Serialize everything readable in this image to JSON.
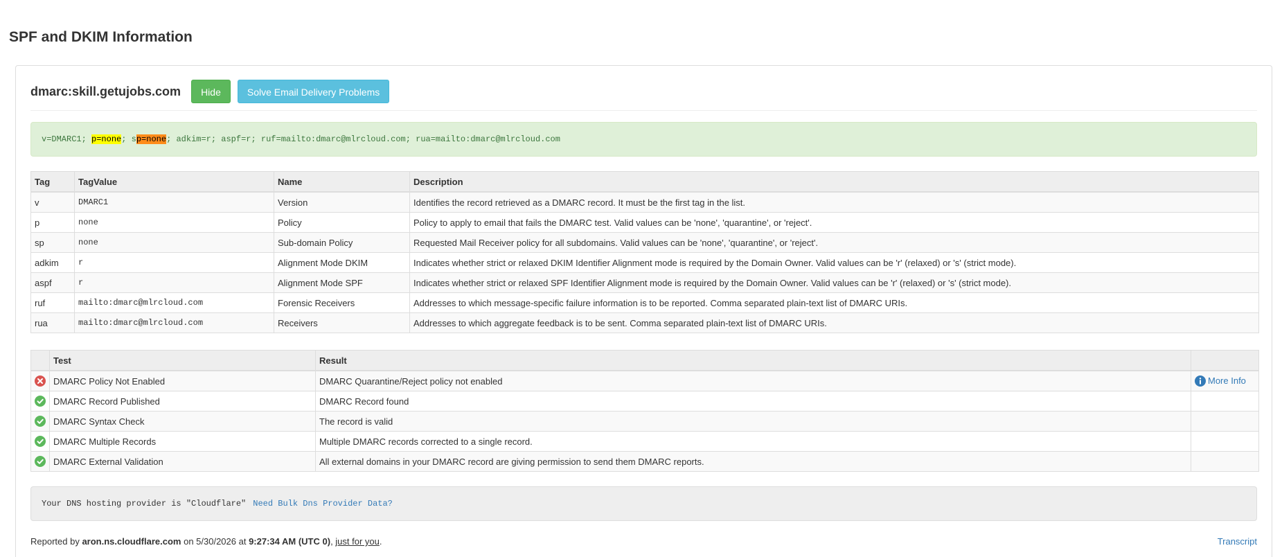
{
  "page_title": "SPF and DKIM Information",
  "header": {
    "domain": "dmarc:skill.getujobs.com",
    "hide_label": "Hide",
    "solve_label": "Solve Email Delivery Problems"
  },
  "record": {
    "part1": "v=DMARC1; ",
    "p_highlight": "p=none",
    "part2": "; s",
    "sp_highlight": "p=none",
    "part3": "; adkim=r; aspf=r; ruf=mailto:dmarc@mlrcloud.com; rua=mailto:dmarc@mlrcloud.com",
    "colors": {
      "green_bg": "#dff0d8",
      "text": "#3c763d",
      "highlight_yellow": "#ffff00",
      "highlight_orange": "#ff8c1a"
    }
  },
  "tag_table": {
    "headers": [
      "Tag",
      "TagValue",
      "Name",
      "Description"
    ],
    "rows": [
      {
        "tag": "v",
        "value": "DMARC1",
        "name": "Version",
        "description": "Identifies the record retrieved as a DMARC record. It must be the first tag in the list."
      },
      {
        "tag": "p",
        "value": "none",
        "name": "Policy",
        "description": "Policy to apply to email that fails the DMARC test. Valid values can be 'none', 'quarantine', or 'reject'."
      },
      {
        "tag": "sp",
        "value": "none",
        "name": "Sub-domain Policy",
        "description": "Requested Mail Receiver policy for all subdomains. Valid values can be 'none', 'quarantine', or 'reject'."
      },
      {
        "tag": "adkim",
        "value": "r",
        "name": "Alignment Mode DKIM",
        "description": "Indicates whether strict or relaxed DKIM Identifier Alignment mode is required by the Domain Owner. Valid values can be 'r' (relaxed) or 's' (strict mode)."
      },
      {
        "tag": "aspf",
        "value": "r",
        "name": "Alignment Mode SPF",
        "description": "Indicates whether strict or relaxed SPF Identifier Alignment mode is required by the Domain Owner. Valid values can be 'r' (relaxed) or 's' (strict mode)."
      },
      {
        "tag": "ruf",
        "value": "mailto:dmarc@mlrcloud.com",
        "name": "Forensic Receivers",
        "description": "Addresses to which message-specific failure information is to be reported. Comma separated plain-text list of DMARC URIs."
      },
      {
        "tag": "rua",
        "value": "mailto:dmarc@mlrcloud.com",
        "name": "Receivers",
        "description": "Addresses to which aggregate feedback is to be sent. Comma separated plain-text list of DMARC URIs."
      }
    ]
  },
  "test_table": {
    "headers": [
      "",
      "Test",
      "Result",
      ""
    ],
    "rows": [
      {
        "status": "error",
        "icon": "error-icon",
        "test": "DMARC Policy Not Enabled",
        "result": "DMARC Quarantine/Reject policy not enabled",
        "more": "More Info"
      },
      {
        "status": "ok",
        "icon": "check-icon",
        "test": "DMARC Record Published",
        "result": "DMARC Record found",
        "more": ""
      },
      {
        "status": "ok",
        "icon": "check-icon",
        "test": "DMARC Syntax Check",
        "result": "The record is valid",
        "more": ""
      },
      {
        "status": "ok",
        "icon": "check-icon",
        "test": "DMARC Multiple Records",
        "result": "Multiple DMARC records corrected to a single record.",
        "more": ""
      },
      {
        "status": "ok",
        "icon": "check-icon",
        "test": "DMARC External Validation",
        "result": "All external domains in your DMARC record are giving permission to send them DMARC reports.",
        "more": ""
      }
    ],
    "colors": {
      "error": "#d9534f",
      "ok": "#5cb85c",
      "info": "#337ab7"
    }
  },
  "dns": {
    "text": "Your DNS hosting provider is \"Cloudflare\"",
    "link": "Need Bulk Dns Provider Data?"
  },
  "footer": {
    "prefix": "Reported by ",
    "server": "aron.ns.cloudflare.com",
    "on": " on 5/30/2026 at ",
    "time": "9:27:34 AM (UTC 0)",
    "comma": ", ",
    "just": "just for you",
    "period": ".",
    "transcript": "Transcript"
  }
}
